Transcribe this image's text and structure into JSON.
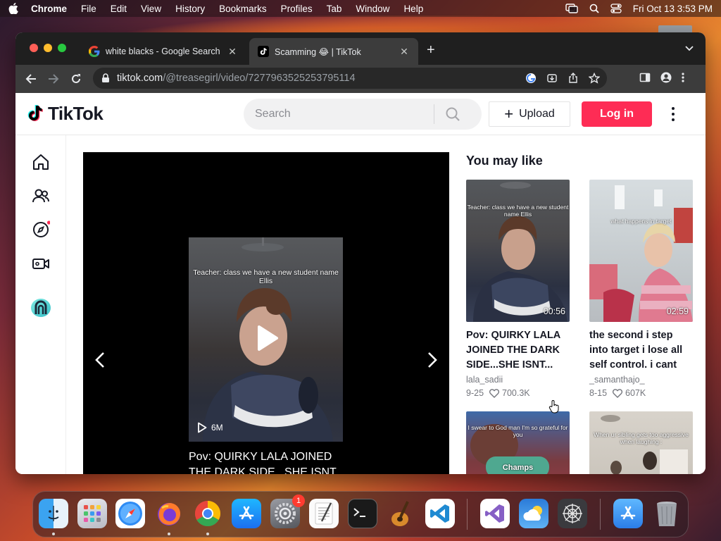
{
  "menubar": {
    "app": "Chrome",
    "items": [
      "File",
      "Edit",
      "View",
      "History",
      "Bookmarks",
      "Profiles",
      "Tab",
      "Window",
      "Help"
    ],
    "clock": "Fri Oct 13  3:53 PM"
  },
  "browser": {
    "tabs": [
      {
        "title": "white blacks - Google Search",
        "favicon": "google-icon",
        "active": false
      },
      {
        "title": "Scamming 😂 | TikTok",
        "favicon": "tiktok-icon",
        "active": true
      }
    ],
    "url_host": "tiktok.com",
    "url_path": "/@treasegirl/video/7277963525253795114"
  },
  "tiktok": {
    "logo_text": "TikTok",
    "search_placeholder": "Search",
    "upload_label": "Upload",
    "login_label": "Log in",
    "accent_color": "#fe2c55",
    "nav": [
      "home-icon",
      "following-icon",
      "explore-icon",
      "live-icon",
      "profile-avatar"
    ],
    "video": {
      "overlay_text": "Teacher: class we have a new student name Ellis",
      "views": "6M",
      "caption": "Pov: QUIRKY LALA JOINED THE DARK SIDE...SHE ISNT..."
    },
    "you_may_like": "You may like",
    "cards": [
      {
        "title": "Pov: QUIRKY LALA JOINED THE DARK SIDE...SHE ISNT...",
        "author": "lala_sadii",
        "date": "9-25",
        "likes": "700.3K",
        "duration": "00:56",
        "thumb_text": "Teacher: class we have a new student name Ellis"
      },
      {
        "title": "the second i step into target i lose all self control. i cant help i...",
        "author": "_samanthajo_",
        "date": "8-15",
        "likes": "607K",
        "duration": "02:59",
        "thumb_text": "what happens in target"
      },
      {
        "title": "",
        "author": "",
        "date": "",
        "likes": "",
        "duration": "",
        "thumb_text": "I swear to God man I'm so grateful for you",
        "badge": "Champs"
      },
      {
        "title": "",
        "author": "",
        "date": "",
        "likes": "",
        "duration": "",
        "thumb_text": "When ur sibling gets too aggressive when laughing :"
      }
    ]
  },
  "dock": {
    "apps": [
      "finder-icon",
      "launchpad-icon",
      "safari-icon",
      "firefox-icon",
      "chrome-icon",
      "app-store-icon",
      "system-settings-icon",
      "textedit-icon",
      "terminal-icon",
      "garageband-icon",
      "vscode-icon",
      "visual-studio-icon",
      "weather-icon",
      "sandbox-icon",
      "app-store-2-icon",
      "trash-icon"
    ],
    "settings_badge": "1"
  }
}
